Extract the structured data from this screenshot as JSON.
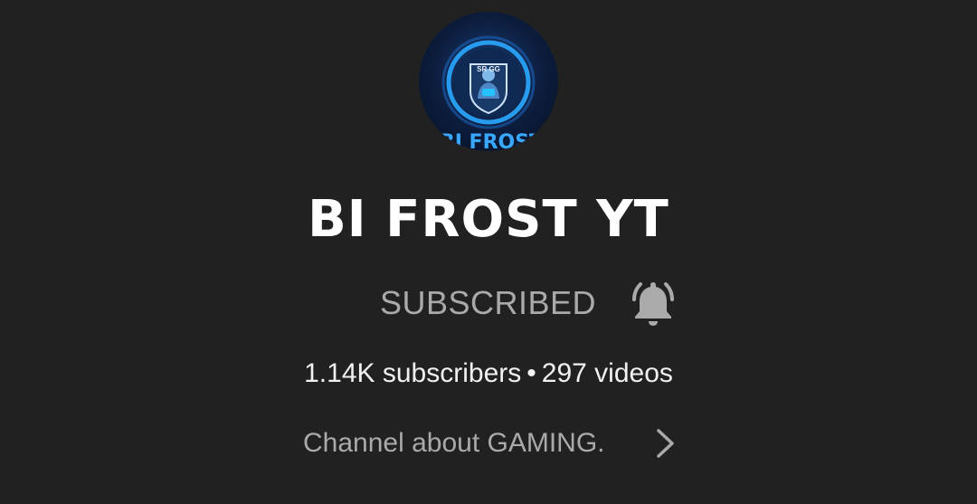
{
  "channel": {
    "name": "BI FROST YT",
    "avatar_text": "BI FROST",
    "avatar_badge_text": "SR GG"
  },
  "subscribe": {
    "label": "SUBSCRIBED",
    "bell_icon": "bell-icon"
  },
  "stats": {
    "subscribers": "1.14K subscribers",
    "separator": "•",
    "videos": "297 videos"
  },
  "about": {
    "text": "Channel about GAMING.",
    "chevron_icon": "chevron-right-icon"
  },
  "colors": {
    "background": "#212121",
    "title": "#ffffff",
    "secondary_text": "#aaaaaa",
    "primary_text": "#f1f1f1",
    "avatar_accent": "#2aa8ff"
  }
}
